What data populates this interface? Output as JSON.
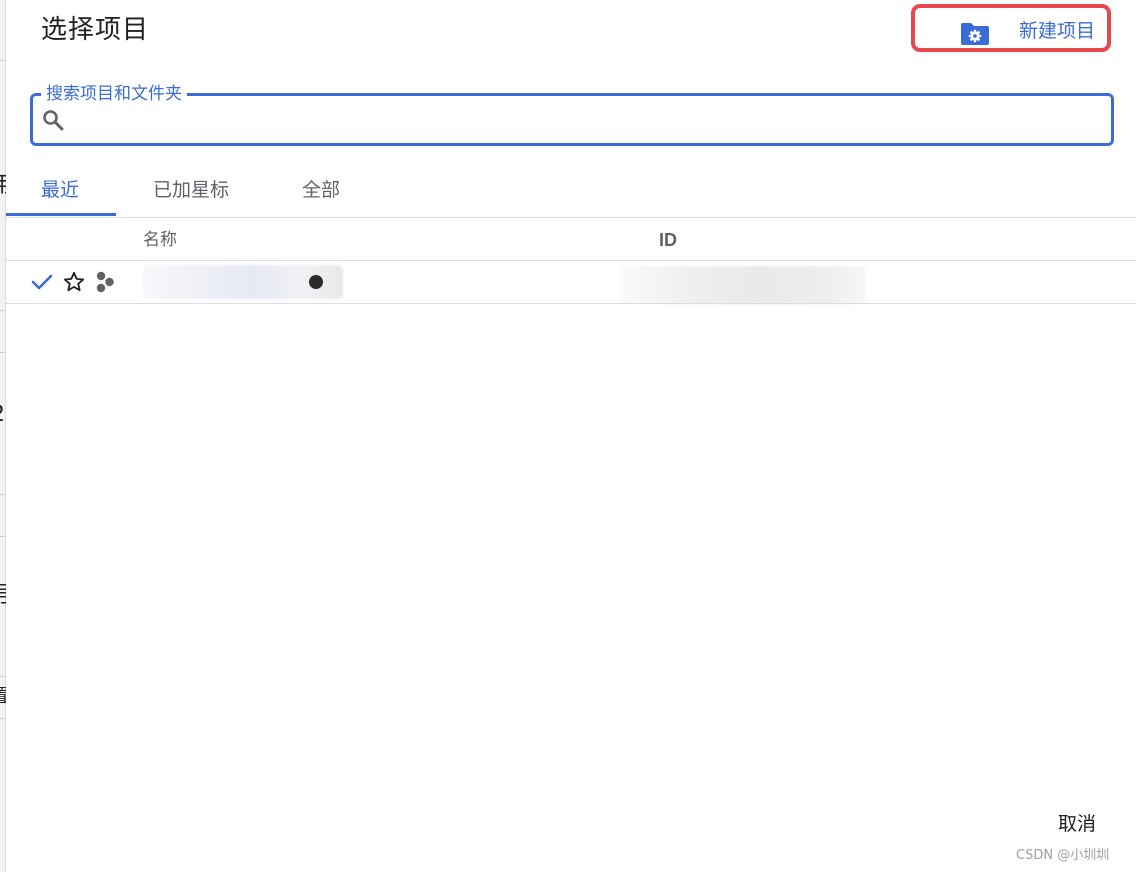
{
  "dialog": {
    "title": "选择项目",
    "new_project_label": "新建项目",
    "cancel_label": "取消"
  },
  "search": {
    "label": "搜索项目和文件夹",
    "value": "",
    "placeholder": ""
  },
  "tabs": [
    {
      "label": "最近",
      "active": true
    },
    {
      "label": "已加星标",
      "active": false
    },
    {
      "label": "全部",
      "active": false
    }
  ],
  "table": {
    "columns": [
      "名称",
      "ID"
    ],
    "rows": [
      {
        "selected": true,
        "starred": false,
        "type_icon": "project-icon",
        "name": "",
        "id": ""
      }
    ]
  },
  "icons": {
    "new_project": "folder-gear-icon",
    "search": "search-icon",
    "selected": "check-icon",
    "star": "star-outline-icon",
    "project": "project-icon"
  },
  "colors": {
    "accent": "#3b6bd6",
    "highlight_box": "#e8484c"
  },
  "watermark": "CSDN @小圳圳"
}
